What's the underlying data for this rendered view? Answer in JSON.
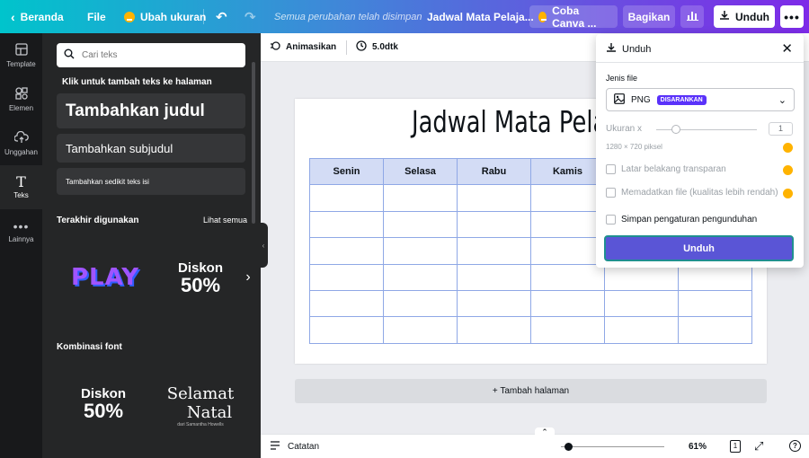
{
  "topbar": {
    "home": "Beranda",
    "file": "File",
    "resize": "Ubah ukuran",
    "save_status": "Semua perubahan telah disimpan",
    "doc_title": "Jadwal Mata Pelaja...",
    "try_pro": "Coba Canva ...",
    "share": "Bagikan",
    "download": "Unduh"
  },
  "rail": {
    "items": [
      {
        "label": "Template",
        "icon": "template-icon"
      },
      {
        "label": "Elemen",
        "icon": "elements-icon"
      },
      {
        "label": "Unggahan",
        "icon": "upload-icon"
      },
      {
        "label": "Teks",
        "icon": "text-icon"
      },
      {
        "label": "Lainnya",
        "icon": "more-icon"
      }
    ]
  },
  "panel": {
    "search_placeholder": "Cari teks",
    "click_hint": "Klik untuk tambah teks ke halaman",
    "add_heading": "Tambahkan judul",
    "add_subheading": "Tambahkan subjudul",
    "add_body": "Tambahkan sedikit teks isi",
    "recent_title": "Terakhir digunakan",
    "see_all": "Lihat semua",
    "font_combos_title": "Kombinasi font",
    "thumb_play": "PLAY",
    "thumb_diskon_title": "Diskon",
    "thumb_diskon_value": "50%",
    "thumb_diskon2_title": "Diskon",
    "thumb_diskon2_value": "50%",
    "thumb_natal_line1": "Selamat",
    "thumb_natal_line2": "Natal",
    "thumb_natal_by": "dari Samantha Howells"
  },
  "subbar": {
    "animate": "Animasikan",
    "duration": "5.0dtk"
  },
  "page": {
    "title": "Jadwal Mata Pelajaran",
    "headers": [
      "Senin",
      "Selasa",
      "Rabu",
      "Kamis",
      "",
      ""
    ],
    "rows": 6,
    "add_page": "+ Tambah halaman"
  },
  "bottombar": {
    "notes": "Catatan",
    "zoom": "61%",
    "page_count": "1"
  },
  "download_panel": {
    "title": "Unduh",
    "file_type_label": "Jenis file",
    "file_type": "PNG",
    "recommended_badge": "DISARANKAN",
    "size_label": "Ukuran x",
    "size_value": "1",
    "dimensions": "1280 × 720 piksel",
    "transparent_bg": "Latar belakang transparan",
    "compress": "Memadatkan file (kualitas lebih rendah)",
    "save_settings": "Simpan pengaturan pengunduhan",
    "download_button": "Unduh"
  },
  "colors": {
    "accent": "#5a32fa",
    "table_header": "#d3dcf5",
    "table_border": "#8fa8e6",
    "pro_crown": "#ffb300"
  }
}
